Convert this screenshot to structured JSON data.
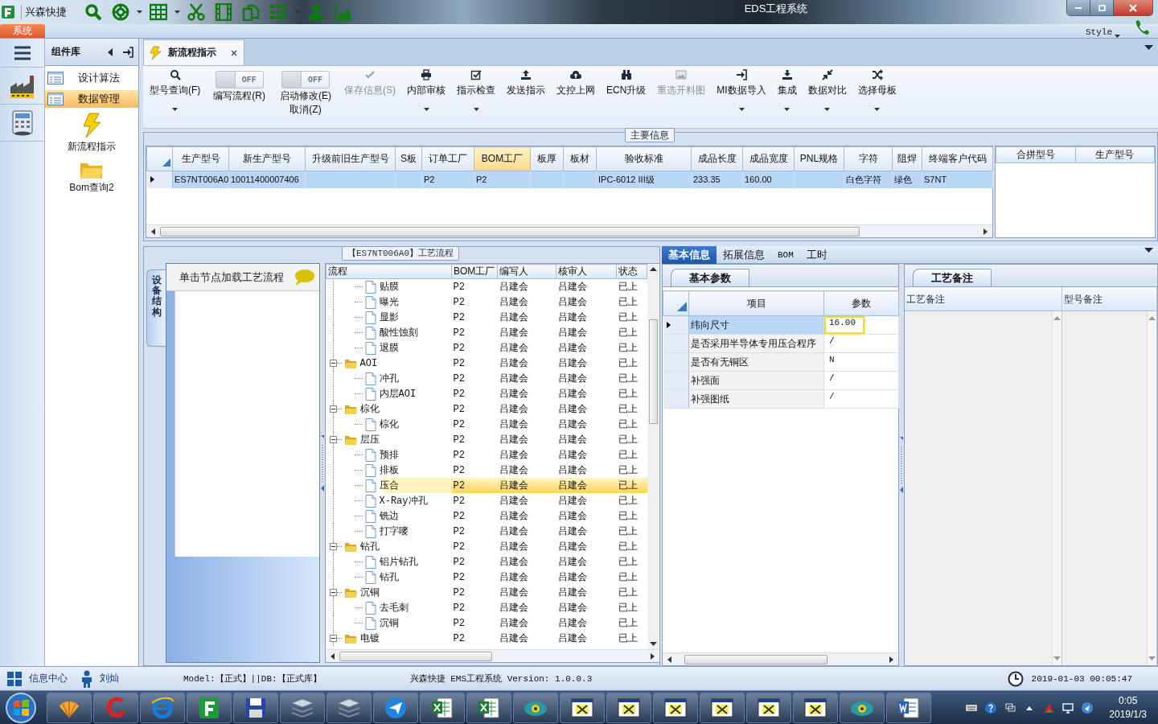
{
  "window": {
    "app_name": "兴森快捷",
    "title": "EDS工程系统"
  },
  "ribbon": {
    "tab": "系统",
    "style_label": "Style"
  },
  "component_panel": {
    "title": "组件库",
    "items": [
      {
        "label": "设计算法",
        "selected": false
      },
      {
        "label": "数据管理",
        "selected": true
      }
    ],
    "tools": [
      {
        "label": "新流程指示"
      },
      {
        "label": "Bom查询2"
      }
    ]
  },
  "doc_tabs": [
    {
      "label": "新流程指示",
      "selected": true
    }
  ],
  "toolbar": [
    {
      "kind": "button",
      "label": "型号查询(F)",
      "dropdown": true,
      "disabled": false
    },
    {
      "kind": "toggle",
      "label": "编写流程(R)",
      "state_text": "OFF",
      "on": false
    },
    {
      "kind": "toggle",
      "label": "启动修改(E)",
      "sublabel": "取消(Z)",
      "state_text": "OFF",
      "on": false
    },
    {
      "kind": "button",
      "label": "保存信息(S)",
      "dropdown": false,
      "disabled": true
    },
    {
      "kind": "button",
      "label": "内部审核",
      "dropdown": true,
      "disabled": false
    },
    {
      "kind": "button",
      "label": "指示检查",
      "dropdown": true,
      "disabled": false
    },
    {
      "kind": "button",
      "label": "发送指示",
      "dropdown": false,
      "disabled": false
    },
    {
      "kind": "button",
      "label": "文控上网",
      "dropdown": false,
      "disabled": false
    },
    {
      "kind": "button",
      "label": "ECN升级",
      "dropdown": false,
      "disabled": false
    },
    {
      "kind": "button",
      "label": "重选开料图",
      "dropdown": false,
      "disabled": true
    },
    {
      "kind": "button",
      "label": "MI数据导入",
      "dropdown": true,
      "disabled": false
    },
    {
      "kind": "button",
      "label": "集成",
      "dropdown": true,
      "disabled": false
    },
    {
      "kind": "button",
      "label": "数据对比",
      "dropdown": true,
      "disabled": false
    },
    {
      "kind": "button",
      "label": "选择母板",
      "dropdown": true,
      "disabled": false
    }
  ],
  "main_info": {
    "title": "主要信息",
    "columns": [
      {
        "label": "生产型号",
        "selected": false
      },
      {
        "label": "新生产型号",
        "selected": false
      },
      {
        "label": "升级前旧生产型号",
        "selected": false
      },
      {
        "label": "S板",
        "selected": false
      },
      {
        "label": "订单工厂",
        "selected": false
      },
      {
        "label": "BOM工厂",
        "selected": true
      },
      {
        "label": "板厚",
        "selected": false
      },
      {
        "label": "板材",
        "selected": false
      },
      {
        "label": "验收标准",
        "selected": false
      },
      {
        "label": "成品长度",
        "selected": false
      },
      {
        "label": "成品宽度",
        "selected": false
      },
      {
        "label": "PNL规格",
        "selected": false
      },
      {
        "label": "字符",
        "selected": false
      },
      {
        "label": "阻焊",
        "selected": false
      },
      {
        "label": "终端客户代码",
        "selected": false
      }
    ],
    "rows": [
      {
        "selected": true,
        "cells": [
          "ES7NT006A0",
          "10011400007406",
          null,
          null,
          "P2",
          "P2",
          null,
          null,
          "IPC-6012 III级",
          "233.35",
          "160.00",
          null,
          "白色字符",
          "绿色",
          "S7NT"
        ]
      }
    ],
    "side_columns": [
      "合拼型号",
      "生产型号"
    ]
  },
  "process": {
    "title": "【ES7NT006A0】工艺流程",
    "side_tab": "设备结构",
    "hint": "单击节点加载工艺流程",
    "columns": [
      "流程",
      "BOM工厂",
      "编写人",
      "核审人",
      "状态"
    ],
    "tree": [
      {
        "children": [
          {
            "label": "贴膜",
            "bom_factory": "P2",
            "author": "吕建会",
            "reviewer": "吕建会",
            "status": "已上",
            "selected": false
          },
          {
            "label": "曝光",
            "bom_factory": "P2",
            "author": "吕建会",
            "reviewer": "吕建会",
            "status": "已上",
            "selected": false
          },
          {
            "label": "显影",
            "bom_factory": "P2",
            "author": "吕建会",
            "reviewer": "吕建会",
            "status": "已上",
            "selected": false
          },
          {
            "label": "酸性蚀刻",
            "bom_factory": "P2",
            "author": "吕建会",
            "reviewer": "吕建会",
            "status": "已上",
            "selected": false
          },
          {
            "label": "退膜",
            "bom_factory": "P2",
            "author": "吕建会",
            "reviewer": "吕建会",
            "status": "已上",
            "selected": false
          }
        ]
      },
      {
        "label": "AOI",
        "bom_factory": "P2",
        "author": "吕建会",
        "reviewer": "吕建会",
        "status": "已上",
        "selected": false,
        "expanded": true,
        "children": [
          {
            "label": "冲孔",
            "bom_factory": "P2",
            "author": "吕建会",
            "reviewer": "吕建会",
            "status": "已上",
            "selected": false
          },
          {
            "label": "内层AOI",
            "bom_factory": "P2",
            "author": "吕建会",
            "reviewer": "吕建会",
            "status": "已上",
            "selected": false
          }
        ]
      },
      {
        "label": "棕化",
        "bom_factory": "P2",
        "author": "吕建会",
        "reviewer": "吕建会",
        "status": "已上",
        "selected": false,
        "expanded": true,
        "children": [
          {
            "label": "棕化",
            "bom_factory": "P2",
            "author": "吕建会",
            "reviewer": "吕建会",
            "status": "已上",
            "selected": false
          }
        ]
      },
      {
        "label": "层压",
        "bom_factory": "P2",
        "author": "吕建会",
        "reviewer": "吕建会",
        "status": "已上",
        "selected": false,
        "expanded": true,
        "children": [
          {
            "label": "预排",
            "bom_factory": "P2",
            "author": "吕建会",
            "reviewer": "吕建会",
            "status": "已上",
            "selected": false
          },
          {
            "label": "排板",
            "bom_factory": "P2",
            "author": "吕建会",
            "reviewer": "吕建会",
            "status": "已上",
            "selected": false
          },
          {
            "label": "压合",
            "bom_factory": "P2",
            "author": "吕建会",
            "reviewer": "吕建会",
            "status": "已上",
            "selected": true
          },
          {
            "label": "X-Ray冲孔",
            "bom_factory": "P2",
            "author": "吕建会",
            "reviewer": "吕建会",
            "status": "已上",
            "selected": false
          },
          {
            "label": "铣边",
            "bom_factory": "P2",
            "author": "吕建会",
            "reviewer": "吕建会",
            "status": "已上",
            "selected": false
          },
          {
            "label": "打字嘜",
            "bom_factory": "P2",
            "author": "吕建会",
            "reviewer": "吕建会",
            "status": "已上",
            "selected": false
          }
        ]
      },
      {
        "label": "钻孔",
        "bom_factory": "P2",
        "author": "吕建会",
        "reviewer": "吕建会",
        "status": "已上",
        "selected": false,
        "expanded": true,
        "children": [
          {
            "label": "铝片钻孔",
            "bom_factory": "P2",
            "author": "吕建会",
            "reviewer": "吕建会",
            "status": "已上",
            "selected": false
          },
          {
            "label": "钻孔",
            "bom_factory": "P2",
            "author": "吕建会",
            "reviewer": "吕建会",
            "status": "已上",
            "selected": false
          }
        ]
      },
      {
        "label": "沉铜",
        "bom_factory": "P2",
        "author": "吕建会",
        "reviewer": "吕建会",
        "status": "已上",
        "selected": false,
        "expanded": true,
        "children": [
          {
            "label": "去毛刺",
            "bom_factory": "P2",
            "author": "吕建会",
            "reviewer": "吕建会",
            "status": "已上",
            "selected": false
          },
          {
            "label": "沉铜",
            "bom_factory": "P2",
            "author": "吕建会",
            "reviewer": "吕建会",
            "status": "已上",
            "selected": false
          }
        ]
      },
      {
        "label": "电镀",
        "bom_factory": "P2",
        "author": "吕建会",
        "reviewer": "吕建会",
        "status": "已上",
        "selected": false,
        "expanded": true
      }
    ]
  },
  "detail": {
    "tabs": [
      {
        "label": "基本信息",
        "selected": true
      },
      {
        "label": "拓展信息",
        "selected": false
      },
      {
        "label": "BOM",
        "selected": false
      },
      {
        "label": "工时",
        "selected": false
      }
    ],
    "params_tab": "基本参数",
    "params_columns": [
      "项目",
      "参数"
    ],
    "params": [
      {
        "item": "纬向尺寸",
        "value": "16.00",
        "selected": true
      },
      {
        "item": "是否采用半导体专用压合程序",
        "value": "/",
        "selected": false
      },
      {
        "item": "是否有无铜区",
        "value": "N",
        "selected": false
      },
      {
        "item": "补强面",
        "value": "/",
        "selected": false
      },
      {
        "item": "补强图纸",
        "value": "/",
        "selected": false
      }
    ],
    "notes_tab": "工艺备注",
    "notes_columns": [
      "工艺备注",
      "型号备注"
    ]
  },
  "status_bar": {
    "info_center": "信息中心",
    "user": "刘灿",
    "environment": "Model:【正式】||DB:【正式库】",
    "version": "兴森快捷 EMS工程系统 Version: 1.0.0.3",
    "datetime": "2019-01-03 00:05:47"
  },
  "taskbar": {
    "time": "0:05",
    "date": "2019/1/3"
  }
}
